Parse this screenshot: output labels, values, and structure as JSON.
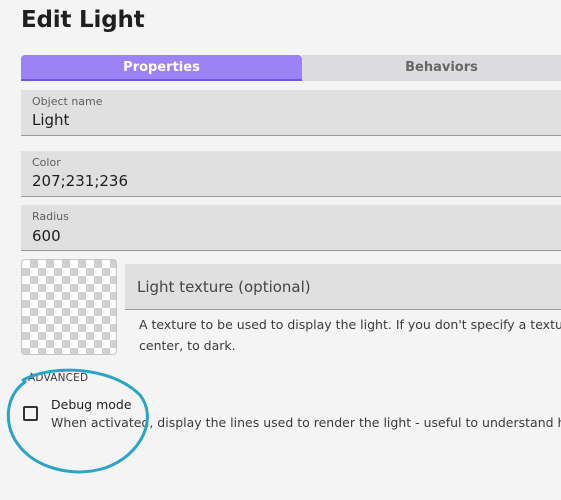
{
  "dialog": {
    "title": "Edit Light"
  },
  "tabs": [
    {
      "label": "Properties",
      "active": true
    },
    {
      "label": "Behaviors",
      "active": false
    }
  ],
  "fields": {
    "object_name": {
      "label": "Object name",
      "value": "Light"
    },
    "color": {
      "label": "Color",
      "value": "207;231;236"
    },
    "radius": {
      "label": "Radius",
      "value": "600"
    }
  },
  "texture": {
    "placeholder": "Light texture (optional)",
    "help_line1": "A texture to be used to display the light. If you don't specify a textu",
    "help_line2": "center, to dark."
  },
  "advanced": {
    "header": "ADVANCED",
    "debug_label": "Debug mode",
    "debug_checked": false,
    "debug_description": "When activated, display the lines used to render the light - useful to understand h"
  },
  "colors": {
    "accent": "#9b82f5",
    "annotation": "#2aa3c6"
  }
}
